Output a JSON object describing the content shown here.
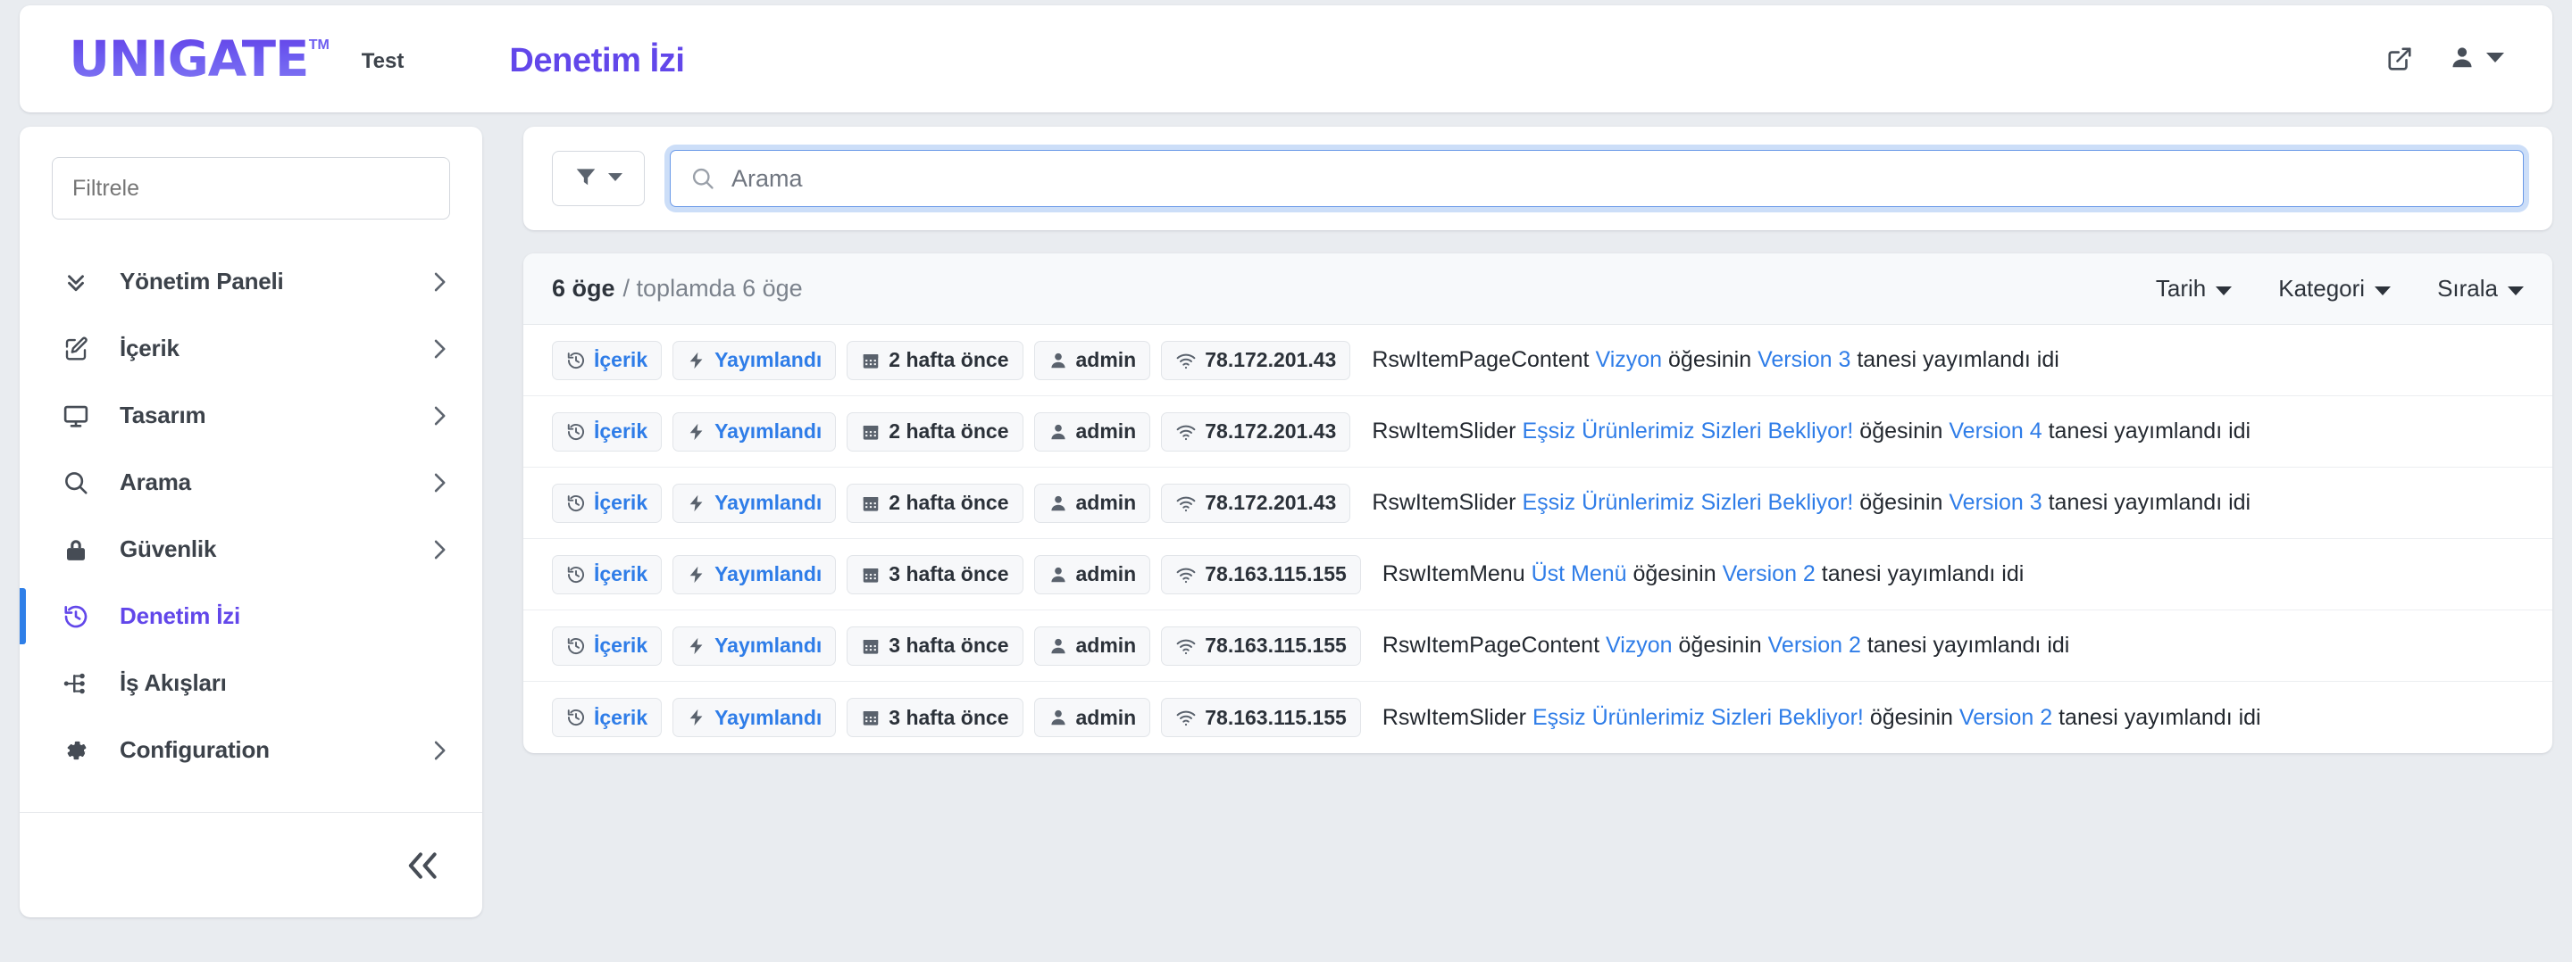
{
  "header": {
    "logo_text": "UNIGATE",
    "logo_tm": "TM",
    "env_label": "Test",
    "page_title": "Denetim İzi",
    "external_link_icon": "external-link-icon",
    "user_icon": "user-icon",
    "user_caret_icon": "chevron-down-icon"
  },
  "sidebar": {
    "filter_placeholder": "Filtrele",
    "filter_value": "",
    "collapse_label": "«",
    "items": [
      {
        "label": "Yönetim Paneli",
        "icon": "chevrons-down-icon",
        "has_caret": true,
        "active": false
      },
      {
        "label": "İçerik",
        "icon": "edit-square-icon",
        "has_caret": true,
        "active": false
      },
      {
        "label": "Tasarım",
        "icon": "monitor-icon",
        "has_caret": true,
        "active": false
      },
      {
        "label": "Arama",
        "icon": "search-icon",
        "has_caret": true,
        "active": false
      },
      {
        "label": "Güvenlik",
        "icon": "lock-icon",
        "has_caret": true,
        "active": false
      },
      {
        "label": "Denetim İzi",
        "icon": "history-icon",
        "has_caret": false,
        "active": true
      },
      {
        "label": "İş Akışları",
        "icon": "workflow-icon",
        "has_caret": false,
        "active": false
      },
      {
        "label": "Configuration",
        "icon": "gear-icon",
        "has_caret": true,
        "active": false
      }
    ]
  },
  "search": {
    "filter_icon": "funnel-icon",
    "filter_caret_icon": "caret-down-icon",
    "search_icon": "search-icon",
    "placeholder": "Arama",
    "value": ""
  },
  "list": {
    "count_strong": "6 öge",
    "count_soft": "/ toplamda 6 öge",
    "dropdowns": [
      {
        "label": "Tarih",
        "icon": "caret-down-icon"
      },
      {
        "label": "Kategori",
        "icon": "caret-down-icon"
      },
      {
        "label": "Sırala",
        "icon": "caret-down-icon"
      }
    ],
    "rows": [
      {
        "category": "İçerik",
        "category_icon": "history-icon",
        "status": "Yayımlandı",
        "status_icon": "lightning-icon",
        "date": "2 hafta önce",
        "date_icon": "calendar-icon",
        "user": "admin",
        "user_icon": "user-icon",
        "ip": "78.172.201.43",
        "ip_icon": "wifi-icon",
        "type": "RswItemPageContent",
        "item": "Vizyon",
        "mid": "öğesinin",
        "version": "Version 3",
        "tail": "tanesi yayımlandı idi"
      },
      {
        "category": "İçerik",
        "category_icon": "history-icon",
        "status": "Yayımlandı",
        "status_icon": "lightning-icon",
        "date": "2 hafta önce",
        "date_icon": "calendar-icon",
        "user": "admin",
        "user_icon": "user-icon",
        "ip": "78.172.201.43",
        "ip_icon": "wifi-icon",
        "type": "RswItemSlider",
        "item": "Eşsiz Ürünlerimiz Sizleri Bekliyor!",
        "mid": "öğesinin",
        "version": "Version 4",
        "tail": "tanesi yayımlandı idi"
      },
      {
        "category": "İçerik",
        "category_icon": "history-icon",
        "status": "Yayımlandı",
        "status_icon": "lightning-icon",
        "date": "2 hafta önce",
        "date_icon": "calendar-icon",
        "user": "admin",
        "user_icon": "user-icon",
        "ip": "78.172.201.43",
        "ip_icon": "wifi-icon",
        "type": "RswItemSlider",
        "item": "Eşsiz Ürünlerimiz Sizleri Bekliyor!",
        "mid": "öğesinin",
        "version": "Version 3",
        "tail": "tanesi yayımlandı idi"
      },
      {
        "category": "İçerik",
        "category_icon": "history-icon",
        "status": "Yayımlandı",
        "status_icon": "lightning-icon",
        "date": "3 hafta önce",
        "date_icon": "calendar-icon",
        "user": "admin",
        "user_icon": "user-icon",
        "ip": "78.163.115.155",
        "ip_icon": "wifi-icon",
        "type": "RswItemMenu",
        "item": "Üst Menü",
        "mid": "öğesinin",
        "version": "Version 2",
        "tail": "tanesi yayımlandı idi"
      },
      {
        "category": "İçerik",
        "category_icon": "history-icon",
        "status": "Yayımlandı",
        "status_icon": "lightning-icon",
        "date": "3 hafta önce",
        "date_icon": "calendar-icon",
        "user": "admin",
        "user_icon": "user-icon",
        "ip": "78.163.115.155",
        "ip_icon": "wifi-icon",
        "type": "RswItemPageContent",
        "item": "Vizyon",
        "mid": "öğesinin",
        "version": "Version 2",
        "tail": "tanesi yayımlandı idi"
      },
      {
        "category": "İçerik",
        "category_icon": "history-icon",
        "status": "Yayımlandı",
        "status_icon": "lightning-icon",
        "date": "3 hafta önce",
        "date_icon": "calendar-icon",
        "user": "admin",
        "user_icon": "user-icon",
        "ip": "78.163.115.155",
        "ip_icon": "wifi-icon",
        "type": "RswItemSlider",
        "item": "Eşsiz Ürünlerimiz Sizleri Bekliyor!",
        "mid": "öğesinin",
        "version": "Version 2",
        "tail": "tanesi yayımlandı idi"
      }
    ]
  },
  "colors": {
    "brand_purple": "#6247ea",
    "link_blue": "#2f7de8",
    "active_bar": "#2f7fe8",
    "page_bg": "#e9ecf0"
  }
}
